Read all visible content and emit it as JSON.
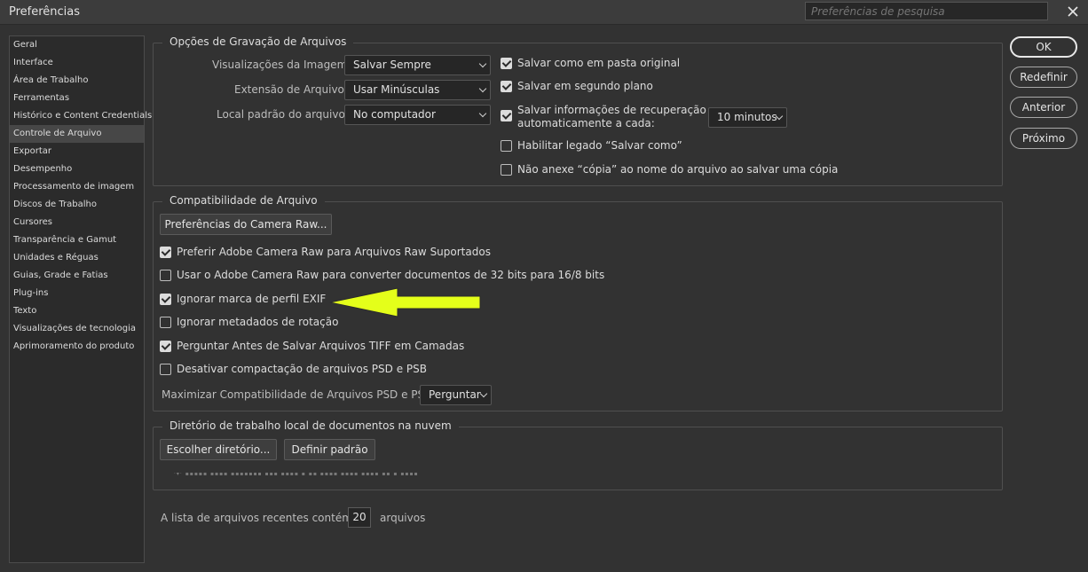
{
  "window": {
    "title": "Preferências",
    "search_placeholder": "Preferências de pesquisa"
  },
  "sidebar": {
    "items": [
      {
        "label": "Geral"
      },
      {
        "label": "Interface"
      },
      {
        "label": "Área de Trabalho"
      },
      {
        "label": "Ferramentas"
      },
      {
        "label": "Histórico e Content Credentials"
      },
      {
        "label": "Controle de Arquivo"
      },
      {
        "label": "Exportar"
      },
      {
        "label": "Desempenho"
      },
      {
        "label": "Processamento de imagem"
      },
      {
        "label": "Discos de Trabalho"
      },
      {
        "label": "Cursores"
      },
      {
        "label": "Transparência e Gamut"
      },
      {
        "label": "Unidades e Réguas"
      },
      {
        "label": "Guias, Grade e Fatias"
      },
      {
        "label": "Plug-ins"
      },
      {
        "label": "Texto"
      },
      {
        "label": "Visualizações de tecnologia"
      },
      {
        "label": "Aprimoramento do produto"
      }
    ],
    "selected": "Controle de Arquivo"
  },
  "save_options": {
    "title": "Opções de Gravação de Arquivos",
    "image_previews_label": "Visualizações da Imagem:",
    "image_previews_value": "Salvar Sempre",
    "extension_label": "Extensão de Arquivo:",
    "extension_value": "Usar Minúsculas",
    "default_location_label": "Local padrão do arquivo:",
    "default_location_value": "No computador",
    "save_original_folder": "Salvar como em pasta original",
    "save_background": "Salvar em segundo plano",
    "auto_recovery_line1": "Salvar informações de recuperação",
    "auto_recovery_line2": "automaticamente a cada:",
    "recovery_interval": "10 minutos",
    "legacy_save_as": "Habilitar legado “Salvar como”",
    "no_copy_suffix": "Não anexe “cópia” ao nome do arquivo ao salvar uma cópia"
  },
  "compat": {
    "title": "Compatibilidade de Arquivo",
    "camera_raw_prefs_button": "Preferências do Camera Raw...",
    "prefer_acr": "Preferir Adobe Camera Raw para Arquivos Raw Suportados",
    "use_acr_32bit": "Usar o Adobe Camera Raw para converter documentos de 32 bits para 16/8 bits",
    "ignore_exif": "Ignorar marca de perfil EXIF",
    "ignore_rotation": "Ignorar metadados de rotação",
    "ask_tiff_layers": "Perguntar Antes de Salvar Arquivos TIFF em Camadas",
    "disable_psd_compression": "Desativar compactação de arquivos PSD e PSB",
    "maximize_label": "Maximizar Compatibilidade de Arquivos PSD e PSB:",
    "maximize_value": "Perguntar"
  },
  "cloud": {
    "title": "Diretório de trabalho local de documentos na nuvem",
    "choose_button": "Escolher diretório...",
    "default_button": "Definir padrão",
    "blurred_path": "·▾·  ▪▪▪▪▪ ▪▪▪▪ ▪▪▪▪▪▪▪   ▪▪▪ ▪▪▪▪   ▪ ▪▪   ▪▪▪▪ ▪▪▪▪ ▪▪▪▪   ▪▪ ▪   ▪▪▪▪"
  },
  "recent": {
    "label": "A lista de arquivos recentes contém:",
    "value": "20",
    "suffix": "arquivos"
  },
  "buttons": {
    "ok": "OK",
    "reset": "Redefinir",
    "previous": "Anterior",
    "next": "Próximo"
  },
  "colors": {
    "annotation_arrow": "#e4ff1a"
  }
}
